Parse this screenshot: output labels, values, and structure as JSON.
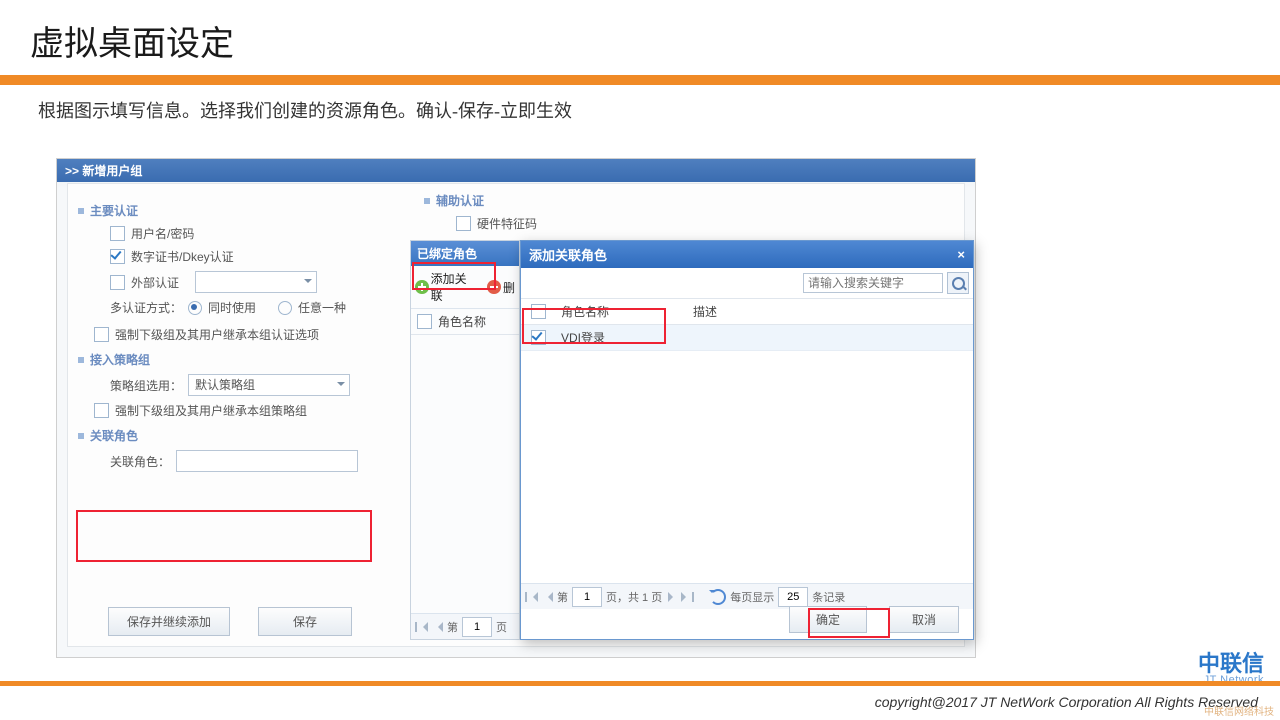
{
  "slide": {
    "title": "虚拟桌面设定",
    "instructions": "根据图示填写信息。选择我们创建的资源角色。确认-保存-立即生效"
  },
  "screenshot": {
    "breadcrumb": ">> 新增用户组",
    "main_auth": {
      "title": "主要认证",
      "userpass": "用户名/密码",
      "cert": "数字证书/Dkey认证",
      "external": "外部认证",
      "multi_label": "多认证方式：",
      "both": "同时使用",
      "any": "任意一种",
      "inherit_auth": "强制下级组及其用户继承本组认证选项"
    },
    "aux_auth": {
      "title": "辅助认证",
      "hw": "硬件特征码"
    },
    "policy": {
      "title": "接入策略组",
      "label": "策略组选用：",
      "default": "默认策略组",
      "inherit_policy": "强制下级组及其用户继承本组策略组"
    },
    "role": {
      "title": "关联角色",
      "label": "关联角色："
    },
    "buttons": {
      "save_continue": "保存并继续添加",
      "save": "保存"
    }
  },
  "bound_panel": {
    "title": "已绑定角色",
    "add": "添加关联",
    "del": "删",
    "col": "角色名称",
    "page_label": "第",
    "page": "1",
    "page_suffix": "页"
  },
  "dialog": {
    "title": "添加关联角色",
    "search_placeholder": "请输入搜索关键字",
    "col_name": "角色名称",
    "col_desc": "描述",
    "row1": "VDI登录",
    "page_label_a": "第",
    "page": "1",
    "page_label_b": "页，共 1 页",
    "perpage_a": "每页显示",
    "perpage_n": "25",
    "perpage_b": "条记录",
    "ok": "确定",
    "cancel": "取消"
  },
  "footer": {
    "brand_main": "中联信",
    "brand_sub": "JT Network",
    "copyright": "copyright@2017  JT NetWork Corporation All Rights Reserved",
    "watermark": "中联信网络科技"
  }
}
